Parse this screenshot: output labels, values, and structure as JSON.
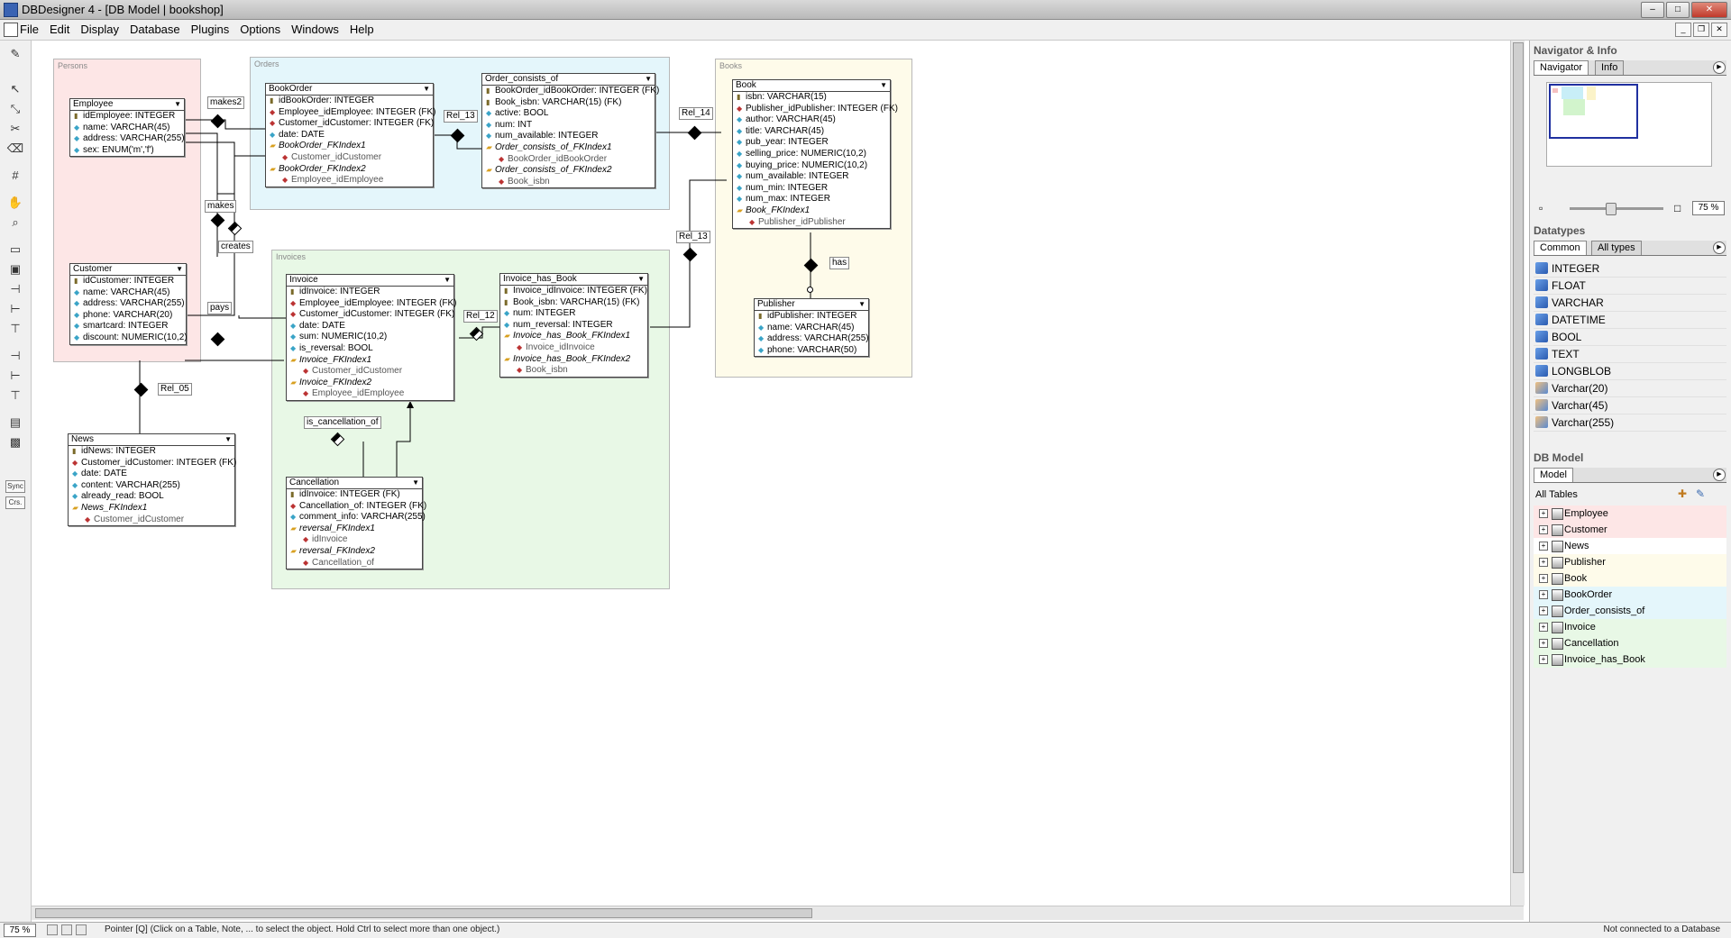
{
  "window": {
    "title": "DBDesigner 4 - [DB Model | bookshop]"
  },
  "menu": [
    "File",
    "Edit",
    "Display",
    "Database",
    "Plugins",
    "Options",
    "Windows",
    "Help"
  ],
  "regions": [
    {
      "id": "persons",
      "label": "Persons",
      "color": "#fde6e6"
    },
    {
      "id": "orders",
      "label": "Orders",
      "color": "#e4f6fb"
    },
    {
      "id": "books",
      "label": "Books",
      "color": "#fefbea"
    },
    {
      "id": "invoices",
      "label": "Invoices",
      "color": "#e8f8e6"
    }
  ],
  "tables": [
    {
      "id": "employee",
      "name": "Employee",
      "rows": [
        {
          "t": "pk",
          "x": "idEmployee: INTEGER"
        },
        {
          "t": "col",
          "x": "name: VARCHAR(45)"
        },
        {
          "t": "col",
          "x": "address: VARCHAR(255)"
        },
        {
          "t": "col",
          "x": "sex: ENUM('m','f')"
        }
      ]
    },
    {
      "id": "customer",
      "name": "Customer",
      "rows": [
        {
          "t": "pk",
          "x": "idCustomer: INTEGER"
        },
        {
          "t": "col",
          "x": "name: VARCHAR(45)"
        },
        {
          "t": "col",
          "x": "address: VARCHAR(255)"
        },
        {
          "t": "col",
          "x": "phone: VARCHAR(20)"
        },
        {
          "t": "col",
          "x": "smartcard: INTEGER"
        },
        {
          "t": "col",
          "x": "discount: NUMERIC(10,2)"
        }
      ]
    },
    {
      "id": "news",
      "name": "News",
      "rows": [
        {
          "t": "pk",
          "x": "idNews: INTEGER"
        },
        {
          "t": "fk",
          "x": "Customer_idCustomer: INTEGER (FK)"
        },
        {
          "t": "col",
          "x": "date: DATE"
        },
        {
          "t": "col",
          "x": "content: VARCHAR(255)"
        },
        {
          "t": "col",
          "x": "already_read: BOOL"
        },
        {
          "t": "idx",
          "x": "News_FKIndex1"
        },
        {
          "t": "idxcol",
          "x": "Customer_idCustomer"
        }
      ]
    },
    {
      "id": "bookorder",
      "name": "BookOrder",
      "rows": [
        {
          "t": "pk",
          "x": "idBookOrder: INTEGER"
        },
        {
          "t": "fk",
          "x": "Employee_idEmployee: INTEGER (FK)"
        },
        {
          "t": "fk",
          "x": "Customer_idCustomer: INTEGER (FK)"
        },
        {
          "t": "col",
          "x": "date: DATE"
        },
        {
          "t": "idx",
          "x": "BookOrder_FKIndex1"
        },
        {
          "t": "idxcol",
          "x": "Customer_idCustomer"
        },
        {
          "t": "idx",
          "x": "BookOrder_FKIndex2"
        },
        {
          "t": "idxcol",
          "x": "Employee_idEmployee"
        }
      ]
    },
    {
      "id": "order_consists_of",
      "name": "Order_consists_of",
      "rows": [
        {
          "t": "pk",
          "x": "BookOrder_idBookOrder: INTEGER (FK)"
        },
        {
          "t": "pk",
          "x": "Book_isbn: VARCHAR(15) (FK)"
        },
        {
          "t": "col",
          "x": "active: BOOL"
        },
        {
          "t": "col",
          "x": "num: INT"
        },
        {
          "t": "col",
          "x": "num_available: INTEGER"
        },
        {
          "t": "idx",
          "x": "Order_consists_of_FKIndex1"
        },
        {
          "t": "idxcol",
          "x": "BookOrder_idBookOrder"
        },
        {
          "t": "idx",
          "x": "Order_consists_of_FKIndex2"
        },
        {
          "t": "idxcol",
          "x": "Book_isbn"
        }
      ]
    },
    {
      "id": "book",
      "name": "Book",
      "rows": [
        {
          "t": "pk",
          "x": "isbn: VARCHAR(15)"
        },
        {
          "t": "fk",
          "x": "Publisher_idPublisher: INTEGER (FK)"
        },
        {
          "t": "col",
          "x": "author: VARCHAR(45)"
        },
        {
          "t": "col",
          "x": "title: VARCHAR(45)"
        },
        {
          "t": "col",
          "x": "pub_year: INTEGER"
        },
        {
          "t": "col",
          "x": "selling_price: NUMERIC(10,2)"
        },
        {
          "t": "col",
          "x": "buying_price: NUMERIC(10,2)"
        },
        {
          "t": "col",
          "x": "num_available: INTEGER"
        },
        {
          "t": "col",
          "x": "num_min: INTEGER"
        },
        {
          "t": "col",
          "x": "num_max: INTEGER"
        },
        {
          "t": "idx",
          "x": "Book_FKIndex1"
        },
        {
          "t": "idxcol",
          "x": "Publisher_idPublisher"
        }
      ]
    },
    {
      "id": "publisher",
      "name": "Publisher",
      "rows": [
        {
          "t": "pk",
          "x": "idPublisher: INTEGER"
        },
        {
          "t": "col",
          "x": "name: VARCHAR(45)"
        },
        {
          "t": "col",
          "x": "address: VARCHAR(255)"
        },
        {
          "t": "col",
          "x": "phone: VARCHAR(50)"
        }
      ]
    },
    {
      "id": "invoice",
      "name": "Invoice",
      "rows": [
        {
          "t": "pk",
          "x": "idInvoice: INTEGER"
        },
        {
          "t": "fk",
          "x": "Employee_idEmployee: INTEGER (FK)"
        },
        {
          "t": "fk",
          "x": "Customer_idCustomer: INTEGER (FK)"
        },
        {
          "t": "col",
          "x": "date: DATE"
        },
        {
          "t": "col",
          "x": "sum: NUMERIC(10,2)"
        },
        {
          "t": "col",
          "x": "is_reversal: BOOL"
        },
        {
          "t": "idx",
          "x": "Invoice_FKIndex1"
        },
        {
          "t": "idxcol",
          "x": "Customer_idCustomer"
        },
        {
          "t": "idx",
          "x": "Invoice_FKIndex2"
        },
        {
          "t": "idxcol",
          "x": "Employee_idEmployee"
        }
      ]
    },
    {
      "id": "invoice_has_book",
      "name": "Invoice_has_Book",
      "rows": [
        {
          "t": "pk",
          "x": "Invoice_idInvoice: INTEGER (FK)"
        },
        {
          "t": "pk",
          "x": "Book_isbn: VARCHAR(15) (FK)"
        },
        {
          "t": "col",
          "x": "num: INTEGER"
        },
        {
          "t": "col",
          "x": "num_reversal: INTEGER"
        },
        {
          "t": "idx",
          "x": "Invoice_has_Book_FKIndex1"
        },
        {
          "t": "idxcol",
          "x": "Invoice_idInvoice"
        },
        {
          "t": "idx",
          "x": "Invoice_has_Book_FKIndex2"
        },
        {
          "t": "idxcol",
          "x": "Book_isbn"
        }
      ]
    },
    {
      "id": "cancellation",
      "name": "Cancellation",
      "rows": [
        {
          "t": "pk",
          "x": "idInvoice: INTEGER (FK)"
        },
        {
          "t": "fk",
          "x": "Cancellation_of: INTEGER (FK)"
        },
        {
          "t": "col",
          "x": "comment_info: VARCHAR(255)"
        },
        {
          "t": "idx",
          "x": "reversal_FKIndex1"
        },
        {
          "t": "idxcol",
          "x": "idInvoice"
        },
        {
          "t": "idx",
          "x": "reversal_FKIndex2"
        },
        {
          "t": "idxcol",
          "x": "Cancellation_of"
        }
      ]
    }
  ],
  "relations": [
    "makes2",
    "makes",
    "creates",
    "pays",
    "Rel_05",
    "Rel_13",
    "Rel_14",
    "Rel_13",
    "has",
    "Rel_12",
    "is_cancellation_of"
  ],
  "navigator": {
    "header": "Navigator & Info",
    "tabs": [
      "Navigator",
      "Info"
    ],
    "zoom": "75 %"
  },
  "datatypes": {
    "header": "Datatypes",
    "tabs": [
      "Common",
      "All types"
    ],
    "items": [
      "INTEGER",
      "FLOAT",
      "VARCHAR",
      "DATETIME",
      "BOOL",
      "TEXT",
      "LONGBLOB",
      "Varchar(20)",
      "Varchar(45)",
      "Varchar(255)"
    ]
  },
  "dbmodel": {
    "header": "DB Model",
    "tab": "Model",
    "all_tables": "All Tables",
    "items": [
      {
        "name": "Employee",
        "color": "#fde6e6"
      },
      {
        "name": "Customer",
        "color": "#fde6e6"
      },
      {
        "name": "News",
        "color": "#ffffff"
      },
      {
        "name": "Publisher",
        "color": "#fefbea"
      },
      {
        "name": "Book",
        "color": "#fefbea"
      },
      {
        "name": "BookOrder",
        "color": "#e4f6fb"
      },
      {
        "name": "Order_consists_of",
        "color": "#e4f6fb"
      },
      {
        "name": "Invoice",
        "color": "#e8f8e6"
      },
      {
        "name": "Cancellation",
        "color": "#e8f8e6"
      },
      {
        "name": "Invoice_has_Book",
        "color": "#e8f8e6"
      }
    ]
  },
  "toolbar": {
    "sync_label": "Sync",
    "crs_label": "Crs."
  },
  "status": {
    "zoom": "75 %",
    "message": "Pointer [Q] (Click on a Table, Note, ... to select the object. Hold Ctrl to select more than one object.)",
    "connection": "Not connected to a Database"
  }
}
